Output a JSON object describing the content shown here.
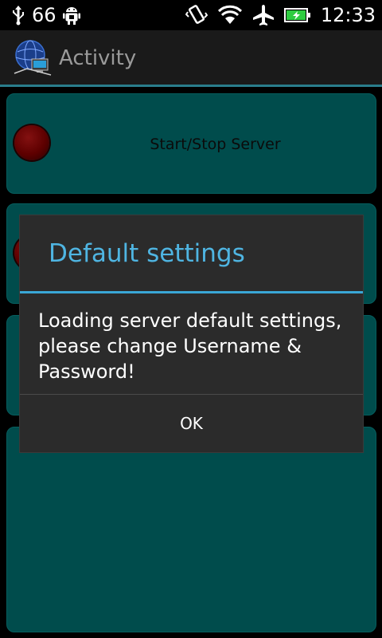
{
  "status_bar": {
    "signal_count": "66",
    "time": "12:33",
    "icons": [
      "usb-icon",
      "android-debug-icon",
      "vibrate-icon",
      "wifi-icon",
      "airplane-mode-icon",
      "battery-charging-icon"
    ]
  },
  "action_bar": {
    "title": "Activity",
    "icon": "network-globe-icon"
  },
  "cards": [
    {
      "label": "Start/Stop Server",
      "status": "off"
    },
    {
      "status": "off"
    },
    {},
    {}
  ],
  "dialog": {
    "title": "Default settings",
    "message": "Loading server default settings, please change Username & Password!",
    "ok_label": "OK"
  },
  "colors": {
    "accent": "#3aa7d6",
    "card": "#007070",
    "led_off": "#8a0000"
  }
}
